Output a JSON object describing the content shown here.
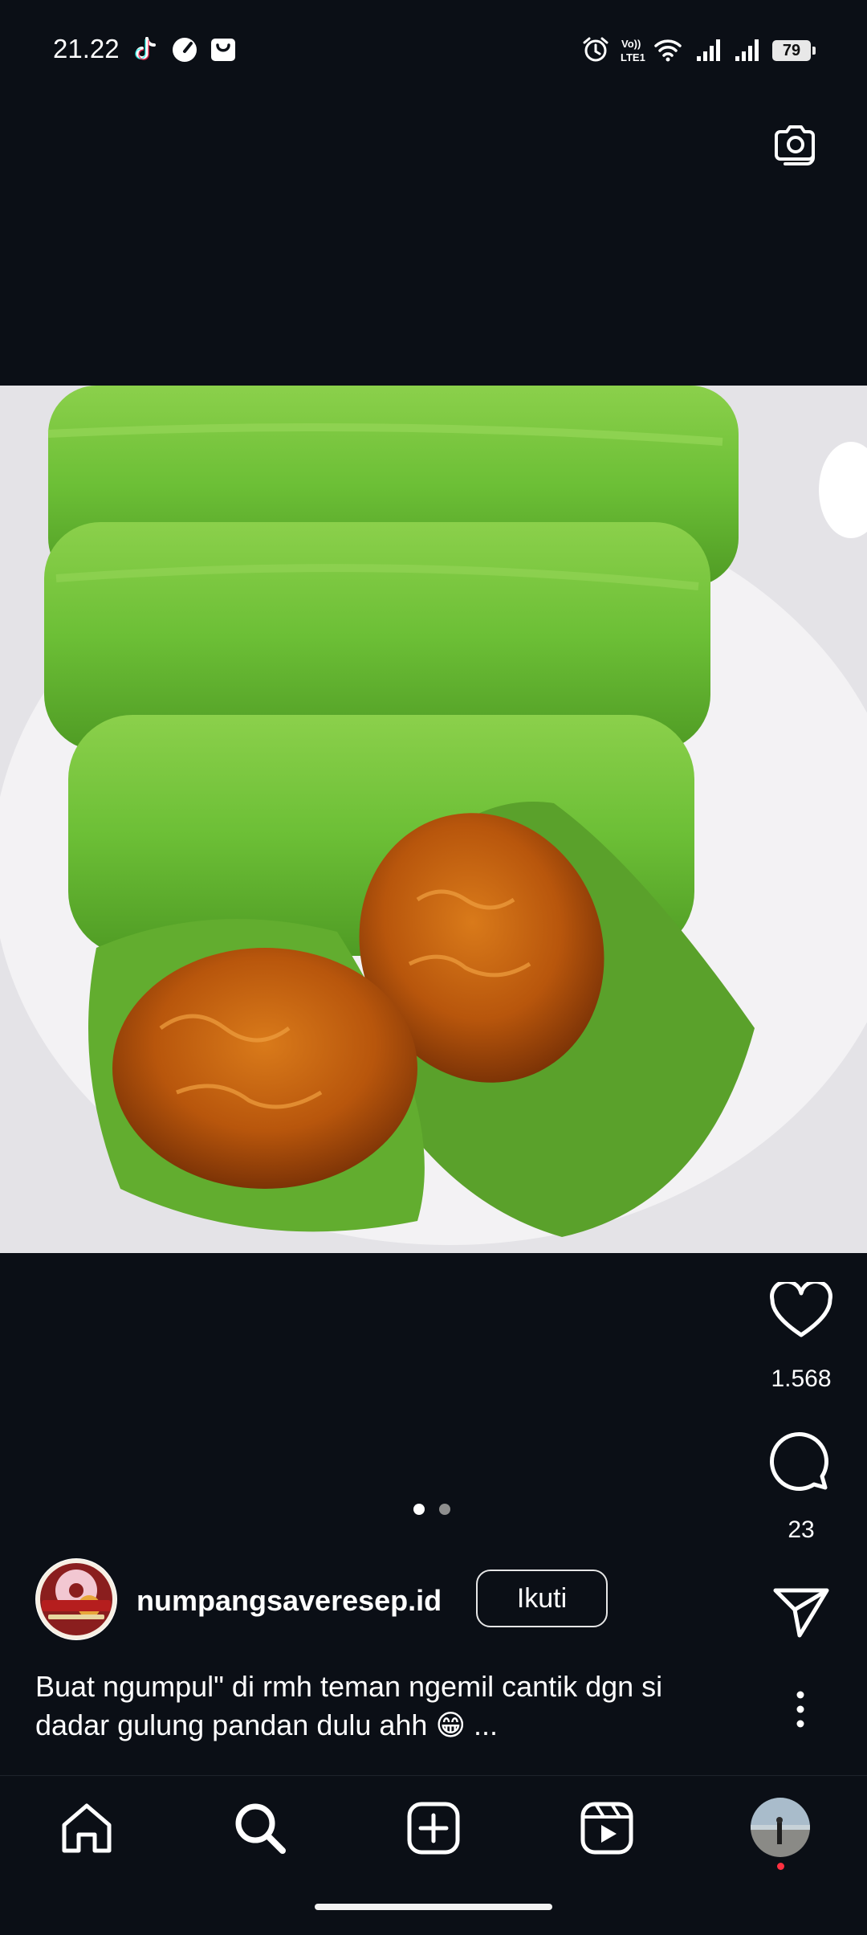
{
  "status_bar": {
    "time": "21.22",
    "battery": "79",
    "icons": [
      "tiktok-icon",
      "speedometer-icon",
      "shopping-bag-icon",
      "alarm-icon",
      "volte-icon",
      "wifi-icon",
      "signal-icon",
      "signal-icon"
    ]
  },
  "post": {
    "image_subject": "green pandan rolled pancakes (dadar gulung) filled with brown sugar coconut",
    "likes": "1.568",
    "comments": "23",
    "carousel": {
      "count": 2,
      "active": 1
    },
    "author": {
      "username": "numpangsaveresep.id",
      "follow_label": "Ikuti"
    },
    "caption": "Buat ngumpul\" di rmh teman ngemil cantik dgn si dadar gulung pandan dulu ahh 😁 ..."
  },
  "nav": {
    "items": [
      "home-icon",
      "search-icon",
      "create-icon",
      "reels-icon",
      "profile-avatar"
    ]
  },
  "colors": {
    "background": "#0b0f16",
    "text": "#ffffff",
    "notification_dot": "#ff3040"
  }
}
